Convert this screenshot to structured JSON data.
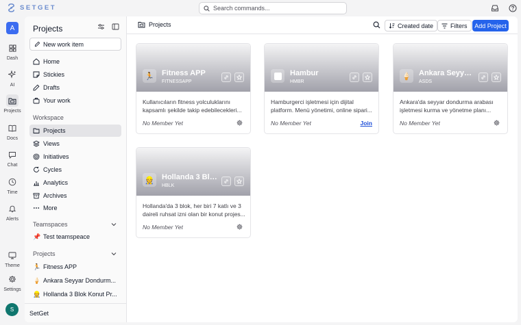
{
  "app": {
    "logo_text": "SETGET"
  },
  "search": {
    "placeholder": "Search commands..."
  },
  "rail": {
    "workspace_initial": "A",
    "items": [
      {
        "label": "Dash",
        "icon": "dashboard-icon"
      },
      {
        "label": "AI",
        "icon": "sparkles-icon"
      },
      {
        "label": "Projects",
        "icon": "folder-icon",
        "active": true
      },
      {
        "label": "Docs",
        "icon": "book-icon"
      },
      {
        "label": "Chat",
        "icon": "chat-icon"
      },
      {
        "label": "Time",
        "icon": "clock-icon"
      },
      {
        "label": "Alerts",
        "icon": "bell-icon"
      },
      {
        "label": "Theme",
        "icon": "monitor-icon"
      },
      {
        "label": "Settings",
        "icon": "gear-icon"
      }
    ],
    "user_initial": "S"
  },
  "sidebar": {
    "title": "Projects",
    "new_item_label": "New work item",
    "nav": [
      {
        "label": "Home",
        "icon": "home-icon"
      },
      {
        "label": "Stickies",
        "icon": "sticky-icon"
      },
      {
        "label": "Drafts",
        "icon": "pencil-icon"
      },
      {
        "label": "Your work",
        "icon": "briefcase-icon"
      }
    ],
    "workspace_label": "Workspace",
    "workspace_items": [
      {
        "label": "Projects",
        "icon": "folder-icon",
        "active": true
      },
      {
        "label": "Views",
        "icon": "layers-icon"
      },
      {
        "label": "Initiatives",
        "icon": "target-icon"
      },
      {
        "label": "Cycles",
        "icon": "cycle-icon"
      },
      {
        "label": "Analytics",
        "icon": "chart-icon"
      },
      {
        "label": "Archives",
        "icon": "archive-icon"
      },
      {
        "label": "More",
        "icon": "more-icon"
      }
    ],
    "teamspaces_label": "Teamspaces",
    "teamspaces": [
      {
        "label": "Test teamspeace",
        "emoji": "📌"
      }
    ],
    "projects_label": "Projects",
    "projects": [
      {
        "label": "Fitness APP",
        "emoji": "🏃"
      },
      {
        "label": "Ankara Seyyar Dondurm...",
        "emoji": "🍦"
      },
      {
        "label": "Hollanda 3 Blok Konut Pr...",
        "emoji": "👷"
      }
    ],
    "footer": "SetGet"
  },
  "main": {
    "breadcrumb": "Projects",
    "sort_label": "Created date",
    "filters_label": "Filters",
    "add_label": "Add Project"
  },
  "cards": [
    {
      "name": "Fitness APP",
      "code": "FITNESSAPP",
      "emoji": "🏃",
      "desc1": "Kullanıcıların fitness yolculuklarını",
      "desc2": "kapsamlı şekilde takip edebilecekleri...",
      "member": "No Member Yet",
      "action": "gear"
    },
    {
      "name": "Hambur",
      "code": "HMBR",
      "emoji": "",
      "desc1": "Hamburgerci işletmesi için dijital",
      "desc2": "platform. Menü yönetimi, online sipari...",
      "member": "No Member Yet",
      "action": "join",
      "join_label": "Join"
    },
    {
      "name": "Ankara Seyyar ...",
      "code": "ASDS",
      "emoji": "🍦",
      "desc1": "Ankara'da seyyar dondurma arabası",
      "desc2": "işletmesi kurma ve yönetme planı...",
      "member": "No Member Yet",
      "action": "gear"
    },
    {
      "name": "Hollanda 3 Blok...",
      "code": "HBLK",
      "emoji": "👷",
      "desc1": "Hollanda'da 3 blok, her biri 7 katlı ve 3",
      "desc2": "daireli ruhsat izni olan bir konut projes...",
      "member": "No Member Yet",
      "action": "gear"
    }
  ]
}
